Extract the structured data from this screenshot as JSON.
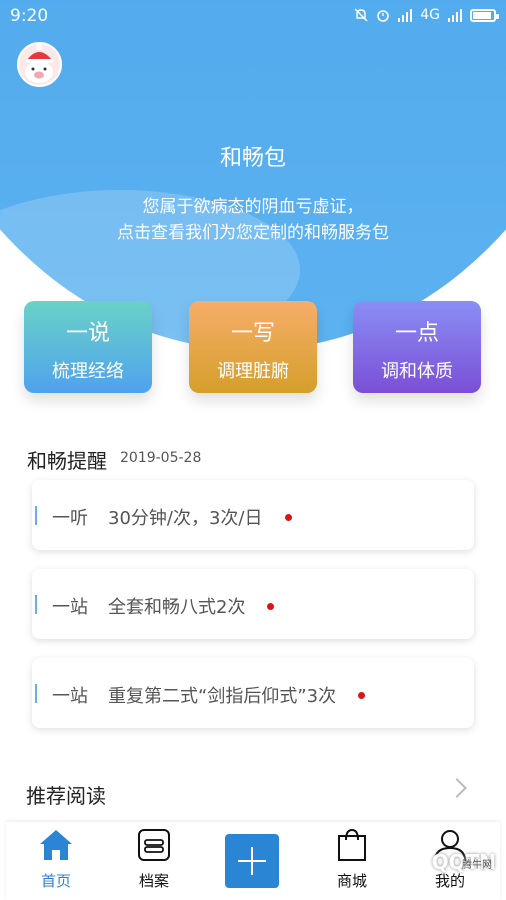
{
  "status_bar": {
    "time": "9:20",
    "network": "4G"
  },
  "header": {
    "title": "和畅包",
    "desc_line1": "您属于欲病态的阴血亏虚证，",
    "desc_line2": "点击查看我们为您定制的和畅服务包"
  },
  "cards": [
    {
      "title": "一说",
      "subtitle": "梳理经络"
    },
    {
      "title": "一写",
      "subtitle": "调理脏腑"
    },
    {
      "title": "一点",
      "subtitle": "调和体质"
    }
  ],
  "reminder": {
    "title": "和畅提醒",
    "date": "2019-05-28",
    "items": [
      {
        "type": "一听",
        "text": "30分钟/次，3次/日"
      },
      {
        "type": "一站",
        "text": "全套和畅八式2次"
      },
      {
        "type": "一站",
        "text": "重复第二式“剑指后仰式”3次"
      }
    ]
  },
  "recommend": {
    "title": "推荐阅读"
  },
  "nav": {
    "items": [
      {
        "label": "首页",
        "icon": "home-icon"
      },
      {
        "label": "档案",
        "icon": "archive-icon"
      },
      {
        "label": "商城",
        "icon": "bag-icon"
      },
      {
        "label": "我的",
        "icon": "user-icon"
      }
    ]
  },
  "watermark": {
    "text": "QQTN",
    "sub": "腾牛网"
  },
  "colors": {
    "primary": "#2a85d4",
    "hero": "#4aa6ea",
    "alert_dot": "#d81616"
  }
}
